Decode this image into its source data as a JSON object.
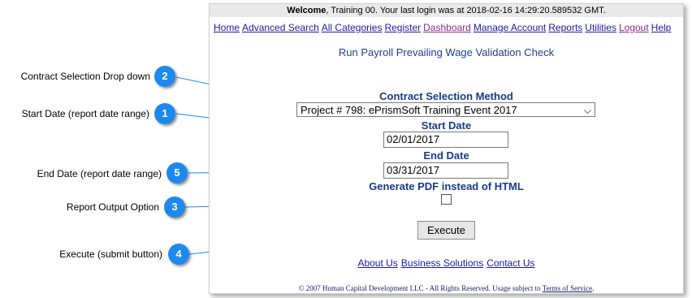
{
  "header": {
    "welcome_bold": "Welcome",
    "welcome_rest": ", Training 00. Your last login was at 2018-02-16 14:29:20.589532 GMT."
  },
  "nav": {
    "items": [
      "Home",
      "Advanced Search",
      "All Categories",
      "Register",
      "Dashboard",
      "Manage Account",
      "Reports",
      "Utilities",
      "Logout",
      "Help"
    ]
  },
  "page_title": "Run Payroll Prevailing Wage Validation Check",
  "form": {
    "contract_label": "Contract Selection Method",
    "contract_value": "Project # 798: ePrismSoft Training Event 2017",
    "start_label": "Start Date",
    "start_value": "02/01/2017",
    "end_label": "End Date",
    "end_value": "03/31/2017",
    "pdf_label": "Generate PDF instead of HTML",
    "execute_label": "Execute"
  },
  "footer": {
    "links": [
      "About Us",
      "Business Solutions",
      "Contact Us"
    ],
    "copyright": "© 2007 Human Capital Development LLC - All Rights Reserved. Usage subject to ",
    "terms": "Terms of Service",
    "copyright_end": "."
  },
  "callouts": [
    {
      "num": "2",
      "label": "Contract Selection Drop down"
    },
    {
      "num": "1",
      "label": "Start Date (report date range)"
    },
    {
      "num": "5",
      "label": "End Date (report date range)"
    },
    {
      "num": "3",
      "label": "Report Output Option"
    },
    {
      "num": "4",
      "label": "Execute (submit button)"
    }
  ],
  "colors": {
    "badge": "#1e88ee",
    "label_blue": "#173a8a",
    "link": "#1a1aa6",
    "visited": "#8b2a8b"
  }
}
